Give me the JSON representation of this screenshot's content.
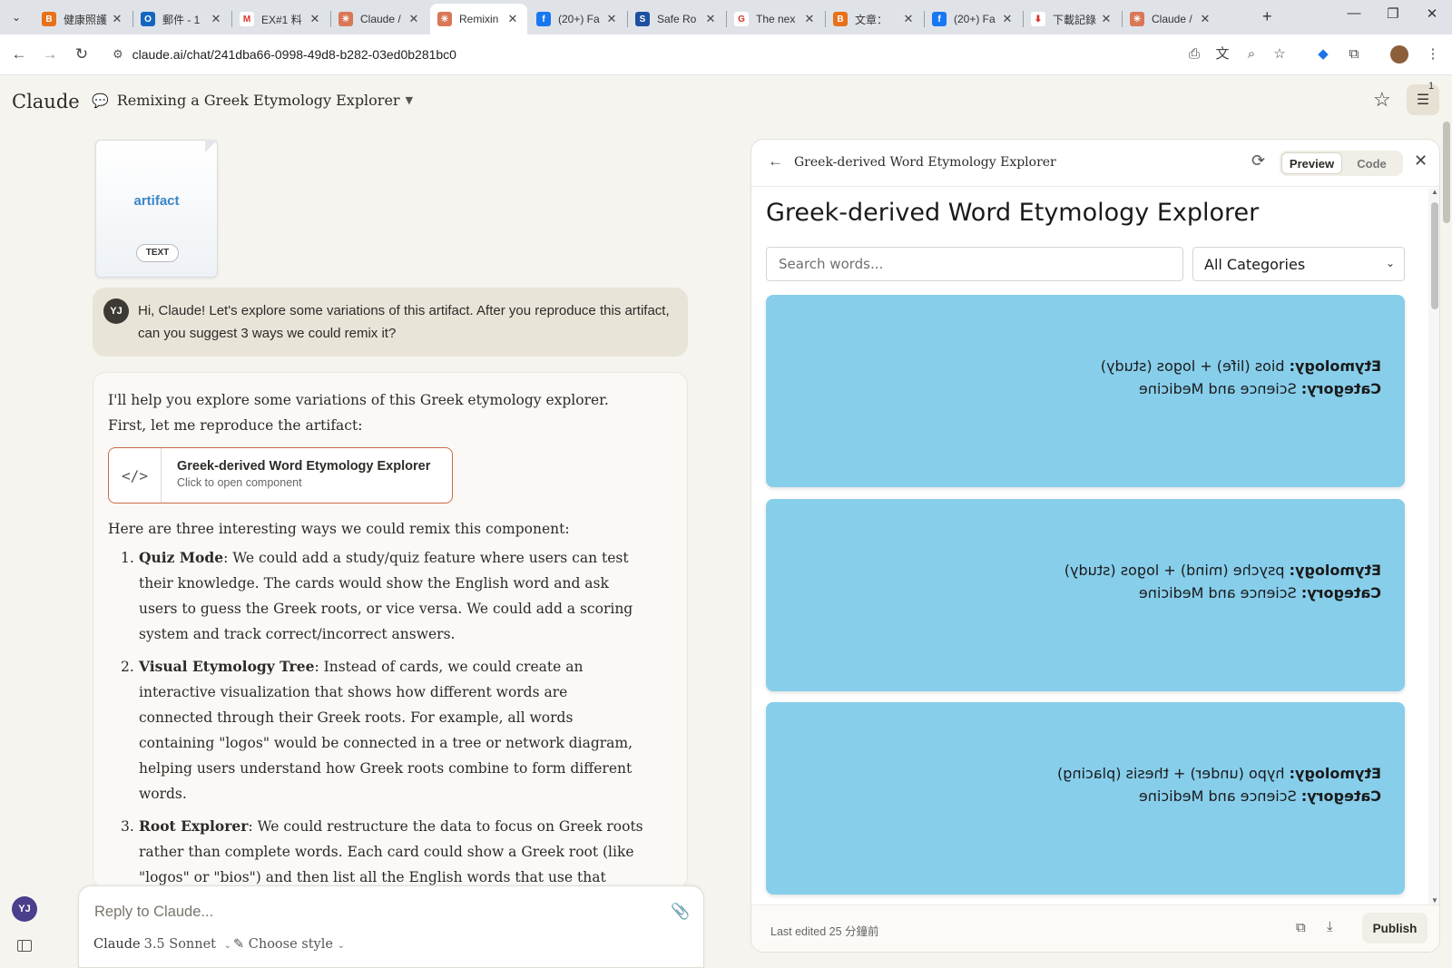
{
  "browser": {
    "tabs": [
      {
        "title": "健康照護",
        "fav_color": "#e8711a",
        "fav_glyph": "B"
      },
      {
        "title": "郵件 - 1",
        "fav_color": "#1565c0",
        "fav_glyph": "O"
      },
      {
        "title": "EX#1 料",
        "fav_color": "#ffffff",
        "fav_glyph": "M"
      },
      {
        "title": "Claude /",
        "fav_color": "#d97757",
        "fav_glyph": "✳"
      },
      {
        "title": "Remixin",
        "fav_color": "#d97757",
        "fav_glyph": "✳"
      },
      {
        "title": "(20+) Fa",
        "fav_color": "#1877f2",
        "fav_glyph": "f"
      },
      {
        "title": "Safe Ro",
        "fav_color": "#1e4fa0",
        "fav_glyph": "S"
      },
      {
        "title": "The nex",
        "fav_color": "#ffffff",
        "fav_glyph": "G"
      },
      {
        "title": "文章：",
        "fav_color": "#e8711a",
        "fav_glyph": "B"
      },
      {
        "title": "(20+) Fa",
        "fav_color": "#1877f2",
        "fav_glyph": "f"
      },
      {
        "title": "下載記錄",
        "fav_color": "#ffffff",
        "fav_glyph": "⬇"
      },
      {
        "title": "Claude /",
        "fav_color": "#d97757",
        "fav_glyph": "✳"
      }
    ],
    "active_tab_index": 4,
    "url": "claude.ai/chat/241dba66-0998-49d8-b282-03ed0b281bc0"
  },
  "header": {
    "logo": "Claude",
    "conversation_title": "Remixing a Greek Etymology Explorer",
    "notification_count": "1"
  },
  "chat": {
    "attachment": {
      "label": "artifact",
      "type": "TEXT"
    },
    "user_initials": "YJ",
    "user_message": "Hi, Claude! Let's explore some variations of this artifact. After you reproduce this artifact, can you suggest 3 ways we could remix it?",
    "assistant": {
      "intro": "I'll help you explore some variations of this Greek etymology explorer. First, let me reproduce the artifact:",
      "artifact_card": {
        "title": "Greek-derived Word Etymology Explorer",
        "subtitle": "Click to open component"
      },
      "lead": "Here are three interesting ways we could remix this component:",
      "items": [
        {
          "num": "1.",
          "title": "Quiz Mode",
          "body": ": We could add a study/quiz feature where users can test their knowledge. The cards would show the English word and ask users to guess the Greek roots, or vice versa. We could add a scoring system and track correct/incorrect answers."
        },
        {
          "num": "2.",
          "title": "Visual Etymology Tree",
          "body": ": Instead of cards, we could create an interactive visualization that shows how different words are connected through their Greek roots. For example, all words containing \"logos\" would be connected in a tree or network diagram, helping users understand how Greek roots combine to form different words."
        },
        {
          "num": "3.",
          "title": "Root Explorer",
          "body": ": We could restructure the data to focus on Greek roots rather than complete words. Each card could show a Greek root (like \"logos\" or \"bios\") and then list all the English words that use that root. This would help users understand how Greek roots are used to build"
        }
      ]
    },
    "composer": {
      "placeholder": "Reply to Claude...",
      "model_name": "Claude",
      "model_version": "3.5 Sonnet",
      "style_label": "Choose style"
    }
  },
  "artifact_panel": {
    "title": "Greek-derived Word Etymology Explorer",
    "tabs": {
      "preview": "Preview",
      "code": "Code"
    },
    "app": {
      "heading": "Greek-derived Word Etymology Explorer",
      "search_placeholder": "Search words...",
      "category_selected": "All Categories",
      "card_color": "#87ceeb",
      "cards": [
        {
          "etym_label": "Etymology:",
          "etymology": " bios (life) + logos (study)",
          "cat_label": "Category:",
          "category": " Science and Medicine"
        },
        {
          "etym_label": "Etymology:",
          "etymology": " psyche (mind) + logos (study)",
          "cat_label": "Category:",
          "category": " Science and Medicine"
        },
        {
          "etym_label": "Etymology:",
          "etymology": " hypo (under) + thesis (placing)",
          "cat_label": "Category:",
          "category": " Science and Medicine"
        }
      ]
    },
    "footer": {
      "edited": "Last edited 25 分鐘前",
      "publish": "Publish"
    }
  },
  "colors": {
    "accent": "#d97757",
    "artifact_border": "#c96a4a",
    "background": "#f5f4ef"
  }
}
